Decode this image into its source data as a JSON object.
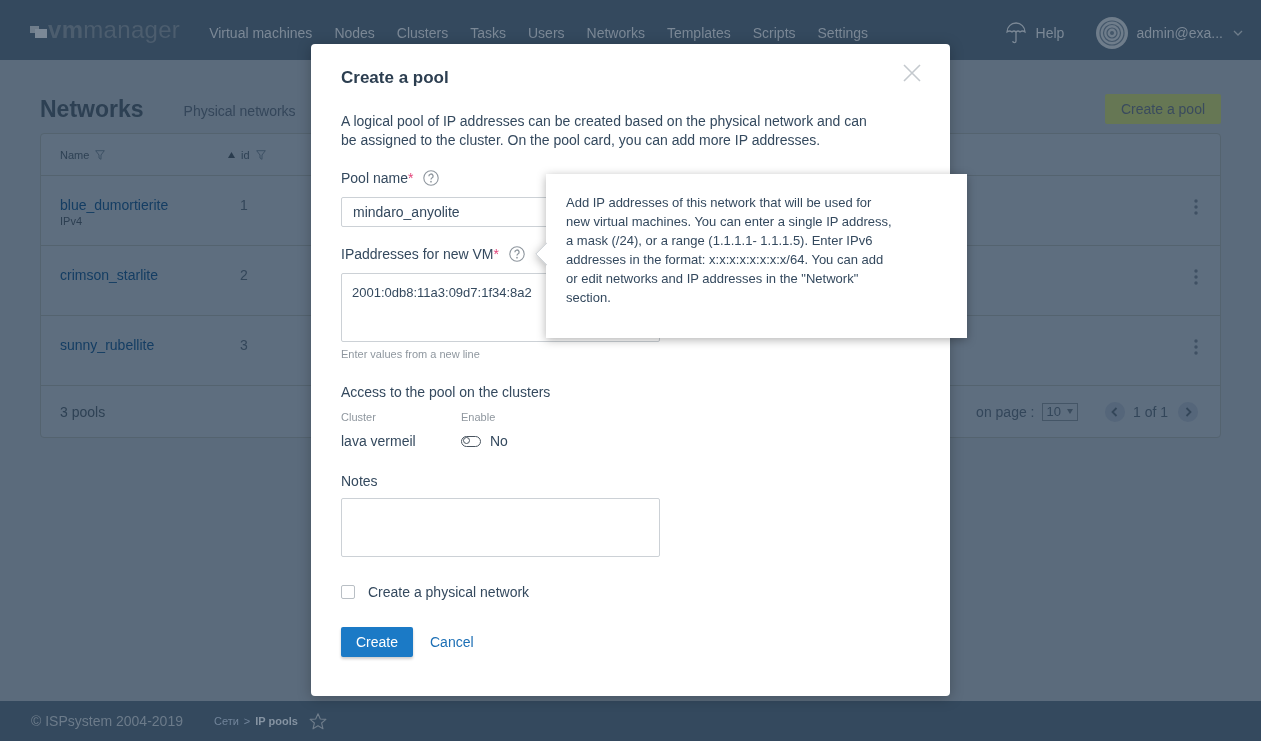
{
  "top_nav": {
    "logo": "**vm**manager",
    "items": [
      {
        "label": "Virtual machines"
      },
      {
        "label": "Nodes"
      },
      {
        "label": "Clusters"
      },
      {
        "label": "Tasks"
      },
      {
        "label": "Users"
      },
      {
        "label": "Networks"
      },
      {
        "label": "Templates"
      },
      {
        "label": "Scripts"
      },
      {
        "label": "Settings"
      }
    ],
    "help": "Help",
    "user": "admin@exa..."
  },
  "page": {
    "title": "Networks",
    "tabs": [
      {
        "label": "Physical networks"
      }
    ],
    "create_button": "Create a pool",
    "table": {
      "columns": [
        {
          "label": "Name",
          "sorted_ascending": false
        },
        {
          "label": "id",
          "sorted_ascending": true
        }
      ],
      "rows": [
        {
          "name": "blue_dumortierite",
          "type": "IPv4",
          "id": "1"
        },
        {
          "name": "crimson_starlite",
          "id": "2"
        },
        {
          "name": "sunny_rubellite",
          "id": "3"
        }
      ],
      "footer": {
        "count": "3 pools",
        "per_page_label": "on page :",
        "per_page": "10",
        "pagination": "1 of 1"
      }
    }
  },
  "dialog": {
    "title": "Create a pool",
    "description": "A logical pool of IP addresses can be created based on the physical network and can be assigned to the cluster. On the pool card, you can add more IP addresses.",
    "fields": [
      {
        "kind": "input",
        "label": "Pool name",
        "required_mark": "*",
        "value": "mindaro_anyolite"
      },
      {
        "kind": "textarea",
        "label": "IPaddresses for new VM",
        "required_mark": "*",
        "value": "2001:0db8:11a3:09d7:1f34:8a2",
        "hint": "Enter values from a new line"
      }
    ],
    "access": {
      "title": "Access to the pool on the clusters",
      "columns": [
        "Cluster",
        "Enable"
      ],
      "rows": [
        {
          "cluster": "lava vermeil",
          "enabled": false,
          "state_label": "No"
        }
      ]
    },
    "notes": {
      "label": "Notes"
    },
    "checkbox": {
      "label": "Create a physical network",
      "checked": false
    },
    "buttons": [
      {
        "label": "Create",
        "kind": "primary"
      },
      {
        "label": "Cancel",
        "kind": "link"
      }
    ]
  },
  "tooltip": {
    "text": "Add IP addresses of this network that will be used for new virtual machines. You can enter a single IP address, a mask (/24), or a range (1.1.1.1- 1.1.1.5). Enter IPv6 addresses in the format: x:x:x:x:x:x:x:x/64. You can add or edit networks and IP addresses in the \"Network\" section."
  },
  "footer": {
    "copyright": "© ISPsystem 2004-2019",
    "breadcrumbs": [
      {
        "label": "Сети"
      },
      {
        "label": "IP pools"
      }
    ],
    "separator": ">"
  }
}
